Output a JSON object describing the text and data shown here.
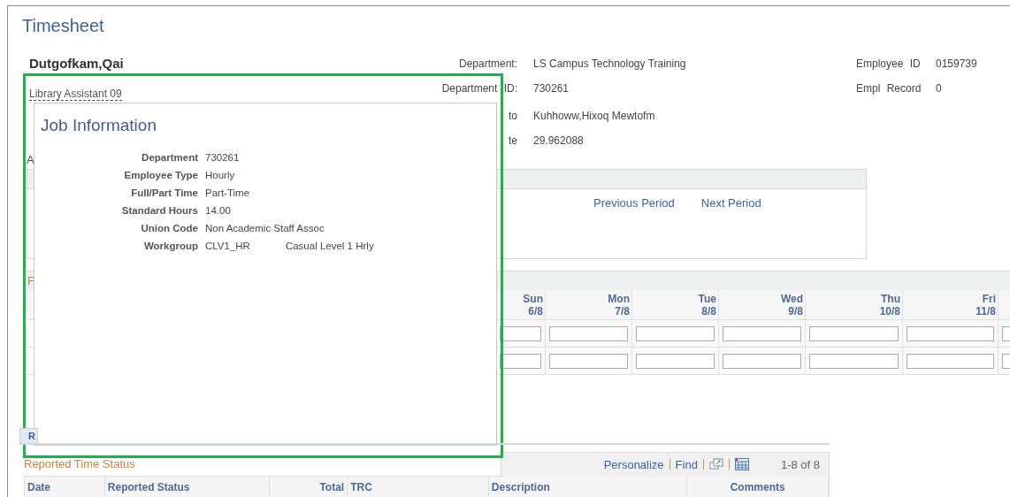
{
  "page_title": "Timesheet",
  "employee": {
    "name": "Dutgofkam,Qai",
    "job_title": "Library Assistant 09"
  },
  "info_fields": [
    {
      "label": "Department:",
      "value": "LS Campus Technology Training"
    },
    {
      "label": "Department ID:",
      "value": "730261"
    },
    {
      "label": "to",
      "value": "Kuhhoww,Hixoq Mewtofm"
    },
    {
      "label": "te",
      "value": "29.962088"
    }
  ],
  "id_fields": [
    {
      "label": "Employee ID",
      "value": "0159739"
    },
    {
      "label": "Empl Record",
      "value": "0"
    }
  ],
  "period_section": {
    "heading": "A",
    "links": [
      "Previous Period",
      "Next Period"
    ]
  },
  "timesheet_grid": {
    "heading": "F",
    "days": [
      {
        "day": "Sun",
        "date": "6/8"
      },
      {
        "day": "Mon",
        "date": "7/8"
      },
      {
        "day": "Tue",
        "date": "8/8"
      },
      {
        "day": "Wed",
        "date": "9/8"
      },
      {
        "day": "Thu",
        "date": "10/8"
      },
      {
        "day": "Fri",
        "date": "11/8"
      }
    ],
    "entry_rows": [
      {
        "kind": "time_entry"
      },
      {
        "kind": "time_entry"
      }
    ]
  },
  "tab_label": "R",
  "reported_time_status": {
    "heading": "Reported Time Status",
    "links": [
      "Personalize",
      "Find"
    ],
    "count": "1-8 of 8",
    "columns": [
      "Date",
      "Reported Status",
      "Total",
      "TRC",
      "Description",
      "Comments"
    ]
  },
  "popup": {
    "title": "Job Information",
    "fields": [
      {
        "label": "Department",
        "value": "730261"
      },
      {
        "label": "Employee Type",
        "value": "Hourly"
      },
      {
        "label": "Full/Part Time",
        "value": "Part-Time"
      },
      {
        "label": "Standard Hours",
        "value": "14.00"
      },
      {
        "label": "Union Code",
        "value": "Non Academic Staff Assoc"
      },
      {
        "label": "Workgroup",
        "value": "CLV1_HR",
        "extra": "Casual Level 1 Hrly"
      }
    ]
  }
}
